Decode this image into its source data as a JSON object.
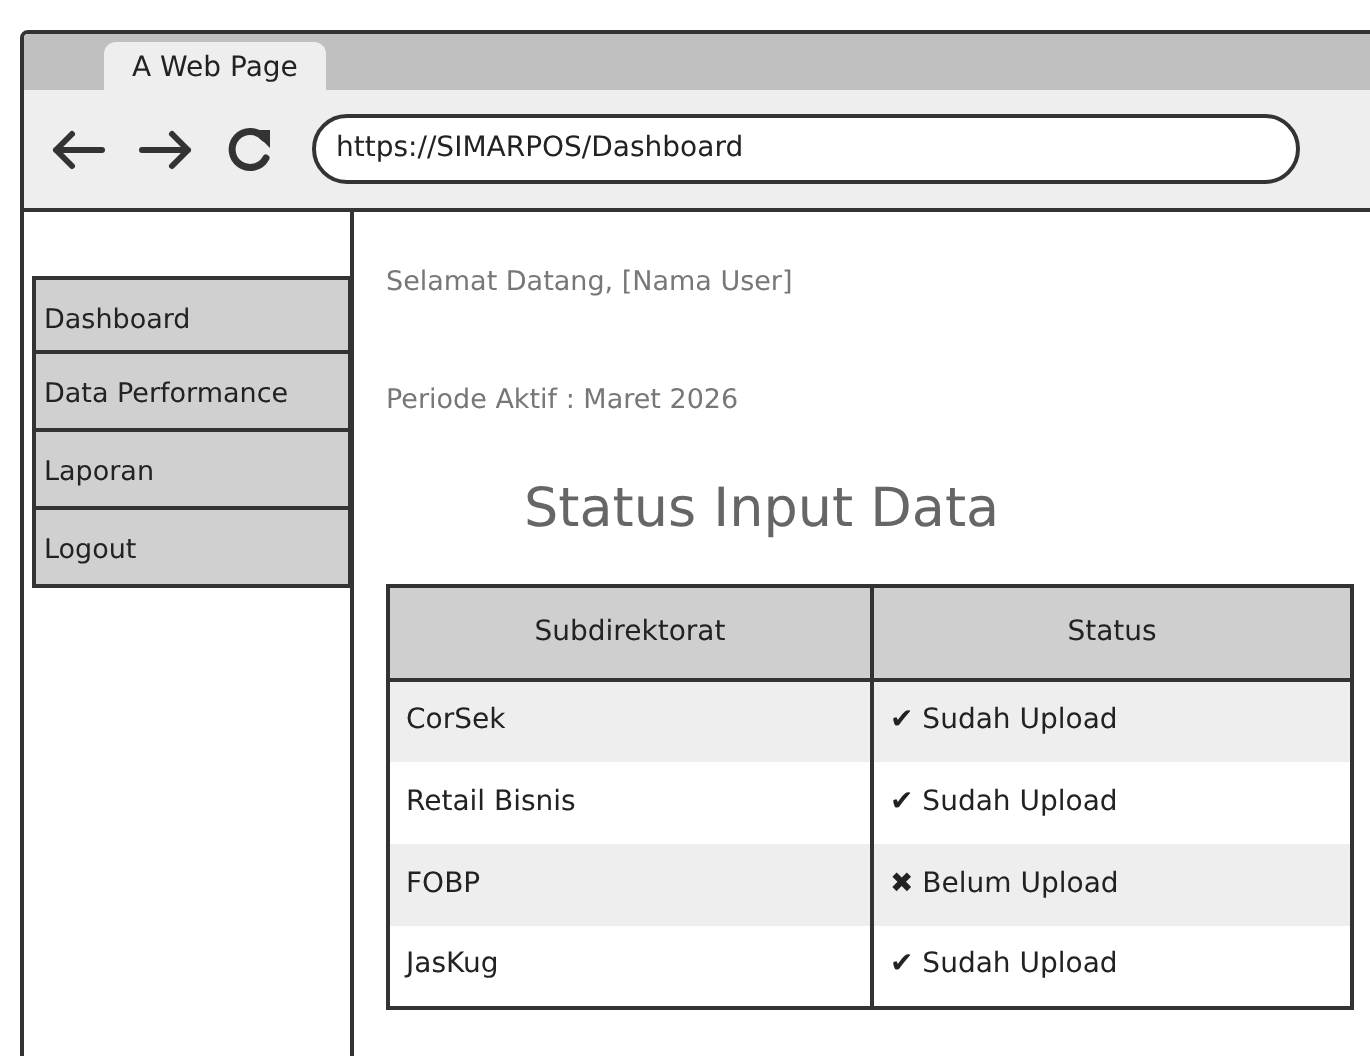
{
  "browser": {
    "tab_title": "A Web Page",
    "url": "https://SIMARPOS/Dashboard"
  },
  "sidebar": {
    "items": [
      {
        "label": "Dashboard"
      },
      {
        "label": "Data Performance"
      },
      {
        "label": "Laporan"
      },
      {
        "label": "Logout"
      }
    ]
  },
  "greeting": "Selamat Datang, [Nama User]",
  "period": "Periode Aktif : Maret 2026",
  "heading": "Status Input Data",
  "table": {
    "columns": [
      "Subdirektorat",
      "Status"
    ],
    "rows": [
      {
        "cells": [
          "CorSek",
          "✔ Sudah Upload"
        ]
      },
      {
        "cells": [
          "Retail Bisnis",
          "✔ Sudah Upload"
        ]
      },
      {
        "cells": [
          "FOBP",
          "✖ Belum Upload"
        ]
      },
      {
        "cells": [
          "JasKug",
          "✔ Sudah Upload"
        ]
      }
    ]
  }
}
